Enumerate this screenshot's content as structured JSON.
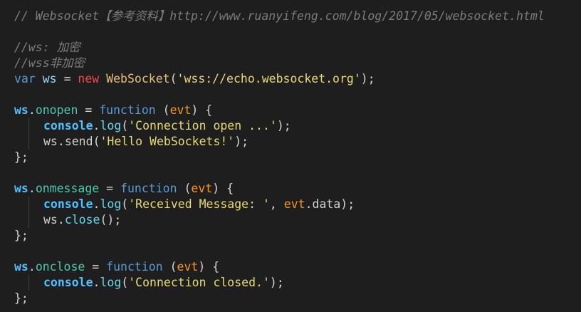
{
  "editor": {
    "theme_colors": {
      "background": "#1e1e1e",
      "comment": "#7c7c7c",
      "keyword": "#569cd6",
      "string": "#e6db74",
      "identifier": "#4fc1ff"
    },
    "lines": [
      {
        "tokens": [
          {
            "text": "// Websocket【参考资料】http://www.ruanyifeng.com/blog/2017/05/websocket.html",
            "type": "comment"
          }
        ]
      },
      {
        "tokens": []
      },
      {
        "tokens": [
          {
            "text": "//ws: 加密",
            "type": "comment"
          }
        ]
      },
      {
        "tokens": [
          {
            "text": "//wss非加密",
            "type": "comment"
          }
        ]
      },
      {
        "tokens": [
          {
            "text": "var",
            "type": "keyword"
          },
          {
            "text": " ws ",
            "type": "var"
          },
          {
            "text": "=",
            "type": "op"
          },
          {
            "text": " new ",
            "type": "new"
          },
          {
            "text": "WebSocket",
            "type": "class"
          },
          {
            "text": "(",
            "type": "punct"
          },
          {
            "text": "'wss://echo.websocket.org'",
            "type": "string"
          },
          {
            "text": ");",
            "type": "punct"
          }
        ]
      },
      {
        "tokens": []
      },
      {
        "tokens": [
          {
            "text": "ws",
            "type": "ident"
          },
          {
            "text": ".",
            "type": "punct"
          },
          {
            "text": "onopen",
            "type": "prop"
          },
          {
            "text": " = ",
            "type": "op"
          },
          {
            "text": "function",
            "type": "func-kw"
          },
          {
            "text": " (",
            "type": "punct"
          },
          {
            "text": "evt",
            "type": "param"
          },
          {
            "text": ") {",
            "type": "punct"
          }
        ]
      },
      {
        "indent": true,
        "tokens": [
          {
            "text": "console",
            "type": "console"
          },
          {
            "text": ".",
            "type": "punct"
          },
          {
            "text": "log",
            "type": "method"
          },
          {
            "text": "(",
            "type": "punct"
          },
          {
            "text": "'Connection open ...'",
            "type": "string"
          },
          {
            "text": ");",
            "type": "punct"
          }
        ]
      },
      {
        "indent": true,
        "tokens": [
          {
            "text": "ws",
            "type": "wstext"
          },
          {
            "text": ".",
            "type": "punct"
          },
          {
            "text": "send",
            "type": "wstext"
          },
          {
            "text": "(",
            "type": "punct"
          },
          {
            "text": "'Hello WebSockets!'",
            "type": "string"
          },
          {
            "text": ");",
            "type": "punct"
          }
        ]
      },
      {
        "tokens": [
          {
            "text": "};",
            "type": "punct"
          }
        ]
      },
      {
        "tokens": []
      },
      {
        "tokens": [
          {
            "text": "ws",
            "type": "ident"
          },
          {
            "text": ".",
            "type": "punct"
          },
          {
            "text": "onmessage",
            "type": "prop"
          },
          {
            "text": " = ",
            "type": "op"
          },
          {
            "text": "function",
            "type": "func-kw"
          },
          {
            "text": " (",
            "type": "punct"
          },
          {
            "text": "evt",
            "type": "param"
          },
          {
            "text": ") {",
            "type": "punct"
          }
        ]
      },
      {
        "indent": true,
        "tokens": [
          {
            "text": "console",
            "type": "console"
          },
          {
            "text": ".",
            "type": "punct"
          },
          {
            "text": "log",
            "type": "method"
          },
          {
            "text": "(",
            "type": "punct"
          },
          {
            "text": "'Received Message: '",
            "type": "string"
          },
          {
            "text": ", ",
            "type": "punct"
          },
          {
            "text": "evt",
            "type": "param"
          },
          {
            "text": ".data);",
            "type": "punct"
          }
        ]
      },
      {
        "indent": true,
        "tokens": [
          {
            "text": "ws",
            "type": "wstext"
          },
          {
            "text": ".",
            "type": "punct"
          },
          {
            "text": "close",
            "type": "method"
          },
          {
            "text": "();",
            "type": "punct"
          }
        ]
      },
      {
        "tokens": [
          {
            "text": "};",
            "type": "punct"
          }
        ]
      },
      {
        "tokens": []
      },
      {
        "tokens": [
          {
            "text": "ws",
            "type": "ident"
          },
          {
            "text": ".",
            "type": "punct"
          },
          {
            "text": "onclose",
            "type": "prop"
          },
          {
            "text": " = ",
            "type": "op"
          },
          {
            "text": "function",
            "type": "func-kw"
          },
          {
            "text": " (",
            "type": "punct"
          },
          {
            "text": "evt",
            "type": "param"
          },
          {
            "text": ") {",
            "type": "punct"
          }
        ]
      },
      {
        "indent": true,
        "tokens": [
          {
            "text": "console",
            "type": "console"
          },
          {
            "text": ".",
            "type": "punct"
          },
          {
            "text": "log",
            "type": "method"
          },
          {
            "text": "(",
            "type": "punct"
          },
          {
            "text": "'Connection closed.'",
            "type": "string"
          },
          {
            "text": ");",
            "type": "punct"
          }
        ]
      },
      {
        "tokens": [
          {
            "text": "};",
            "type": "punct"
          }
        ]
      }
    ]
  }
}
